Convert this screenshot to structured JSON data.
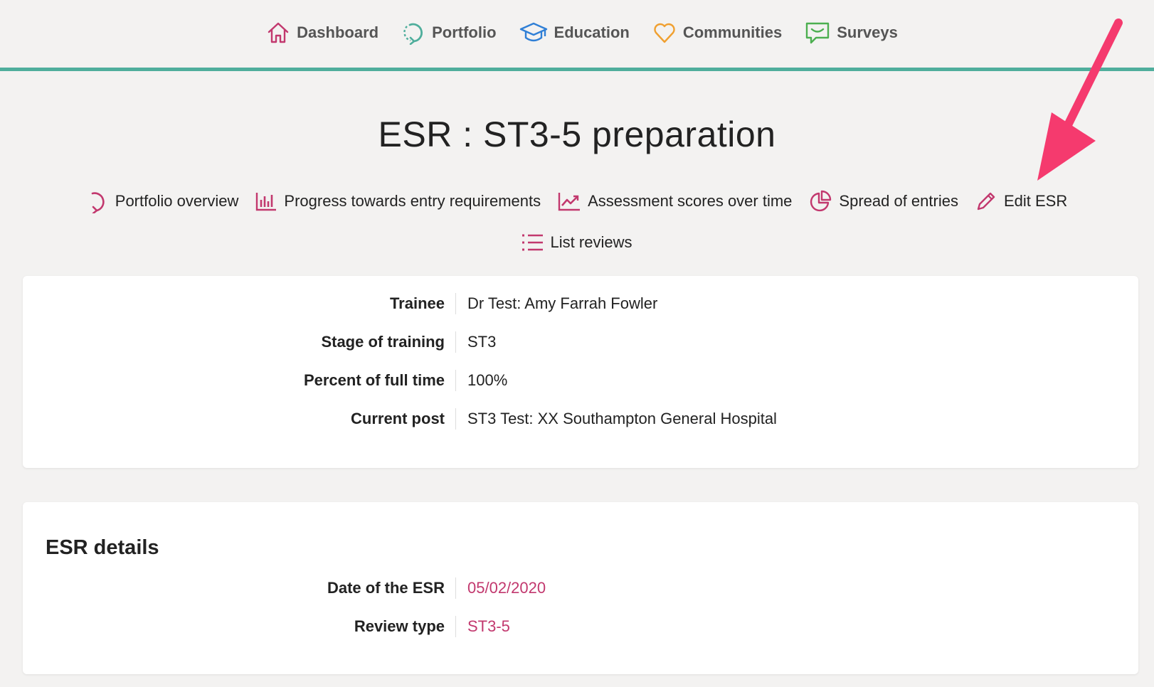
{
  "nav": {
    "items": [
      {
        "label": "Dashboard",
        "icon": "home-icon",
        "color": "#c2386e"
      },
      {
        "label": "Portfolio",
        "icon": "refresh-icon",
        "color": "#4fae9c"
      },
      {
        "label": "Education",
        "icon": "graduation-cap-icon",
        "color": "#2f7fd6"
      },
      {
        "label": "Communities",
        "icon": "heart-icon",
        "color": "#f0a030"
      },
      {
        "label": "Surveys",
        "icon": "chat-icon",
        "color": "#4caf50"
      }
    ]
  },
  "page": {
    "title": "ESR : ST3-5 preparation"
  },
  "actions": [
    {
      "label": "Portfolio overview",
      "icon": "refresh-icon"
    },
    {
      "label": "Progress towards entry requirements",
      "icon": "bar-chart-icon"
    },
    {
      "label": "Assessment scores over time",
      "icon": "line-chart-icon"
    },
    {
      "label": "Spread of entries",
      "icon": "pie-chart-icon"
    },
    {
      "label": "Edit ESR",
      "icon": "pencil-icon"
    },
    {
      "label": "List reviews",
      "icon": "list-icon"
    }
  ],
  "trainee_card": {
    "rows": [
      {
        "label": "Trainee",
        "value": "Dr Test: Amy Farrah Fowler"
      },
      {
        "label": "Stage of training",
        "value": "ST3"
      },
      {
        "label": "Percent of full time",
        "value": "100%"
      },
      {
        "label": "Current post",
        "value": "ST3 Test: XX Southampton General Hospital"
      }
    ]
  },
  "esr_details": {
    "title": "ESR details",
    "rows": [
      {
        "label": "Date of the ESR",
        "value": "05/02/2020"
      },
      {
        "label": "Review type",
        "value": "ST3-5"
      }
    ]
  },
  "colors": {
    "accent": "#c2386e",
    "teal": "#4fae9c",
    "annotation_arrow": "#f53a6e",
    "background": "#f3f2f1"
  }
}
